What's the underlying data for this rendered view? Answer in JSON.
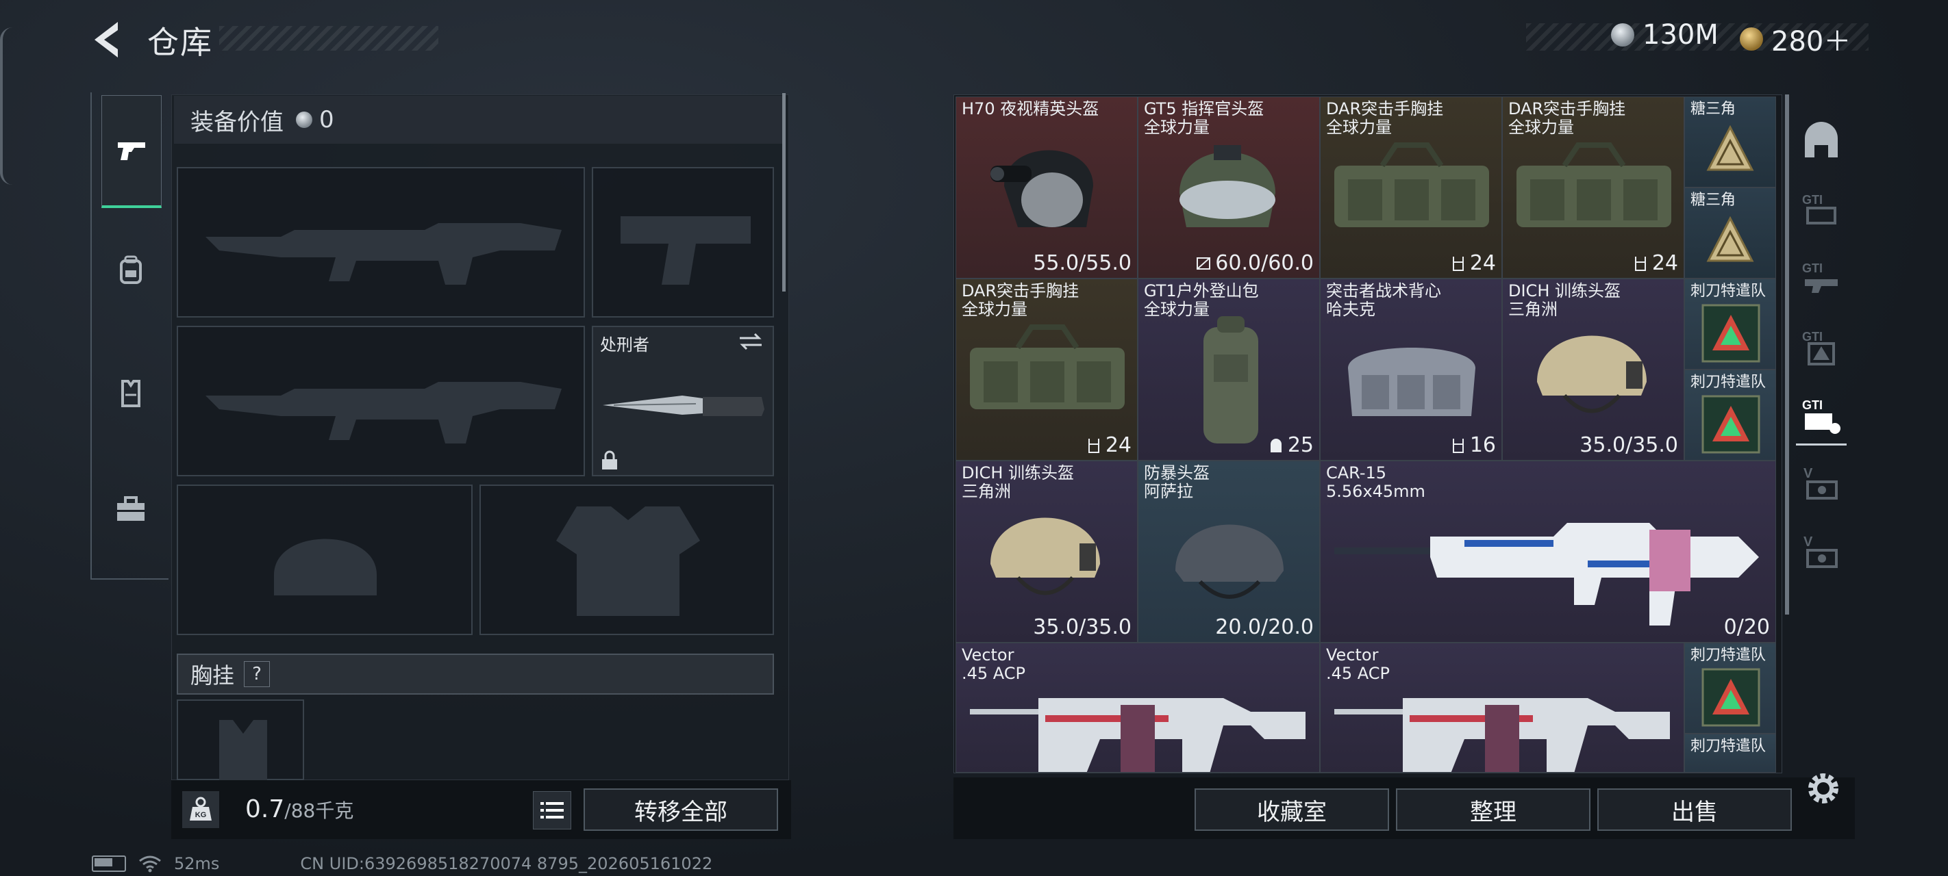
{
  "header": {
    "title": "仓库"
  },
  "currency": {
    "silver": "130M",
    "gold": "280＋"
  },
  "equipment": {
    "value_label": "装备价值",
    "value": "0",
    "melee": {
      "label": "处刑者"
    },
    "chest_rig_label": "胸挂",
    "chest_rig_help": "?"
  },
  "footer": {
    "kg_label": "KG",
    "weight": "0.7",
    "weight_sub": "/88千克",
    "transfer_all": "转移全部"
  },
  "storage": {
    "cells": [
      {
        "name": "H70 夜视精英头盔",
        "sub": "",
        "value": "55.0/55.0",
        "value_icon": ""
      },
      {
        "name": "GT5 指挥官头盔",
        "sub": "全球力量",
        "value": "60.0/60.0",
        "value_icon": "no-repair-icon"
      },
      {
        "name": "DAR突击手胸挂",
        "sub": "全球力量",
        "value": "24",
        "value_icon": "slots-icon"
      },
      {
        "name": "DAR突击手胸挂",
        "sub": "全球力量",
        "value": "24",
        "value_icon": "slots-icon"
      },
      {
        "name": "糖三角",
        "sub": "",
        "value": "",
        "value_icon": ""
      },
      {
        "name": "糖三角",
        "sub": "",
        "value": "",
        "value_icon": ""
      },
      {
        "name": "DAR突击手胸挂",
        "sub": "全球力量",
        "value": "24",
        "value_icon": "slots-icon"
      },
      {
        "name": "GT1户外登山包",
        "sub": "全球力量",
        "value": "25",
        "value_icon": "bag-icon"
      },
      {
        "name": "突击者战术背心",
        "sub": "哈夫克",
        "value": "16",
        "value_icon": "slots-icon"
      },
      {
        "name": "DICH 训练头盔",
        "sub": "三角洲",
        "value": "35.0/35.0",
        "value_icon": ""
      },
      {
        "name": "刺刀特遣队",
        "sub": "",
        "value": "",
        "value_icon": ""
      },
      {
        "name": "刺刀特遣队",
        "sub": "",
        "value": "",
        "value_icon": ""
      },
      {
        "name": "DICH 训练头盔",
        "sub": "三角洲",
        "value": "35.0/35.0",
        "value_icon": ""
      },
      {
        "name": "防暴头盔",
        "sub": "阿萨拉",
        "value": "20.0/20.0",
        "value_icon": ""
      },
      {
        "name": "CAR-15",
        "sub": "5.56x45mm",
        "value": "0/20",
        "value_icon": ""
      },
      {
        "name": "Vector",
        "sub": ".45 ACP",
        "value": "",
        "value_icon": ""
      },
      {
        "name": "Vector",
        "sub": ".45 ACP",
        "value": "",
        "value_icon": ""
      },
      {
        "name": "刺刀特遣队",
        "sub": "",
        "value": "",
        "value_icon": ""
      },
      {
        "name": "刺刀特遣队",
        "sub": "",
        "value": "",
        "value_icon": ""
      }
    ]
  },
  "actions": {
    "collection": "收藏室",
    "sort": "整理",
    "sell": "出售"
  },
  "status_bar": {
    "ping": "52ms",
    "uid": "CN UID:6392698518270074 8795_202605161022"
  },
  "right_tabs": [
    "vault-icon",
    "gti-a-icon",
    "gti-b-icon",
    "gti-c-icon",
    "gti-d-icon",
    "v-a-icon",
    "v-b-icon"
  ]
}
